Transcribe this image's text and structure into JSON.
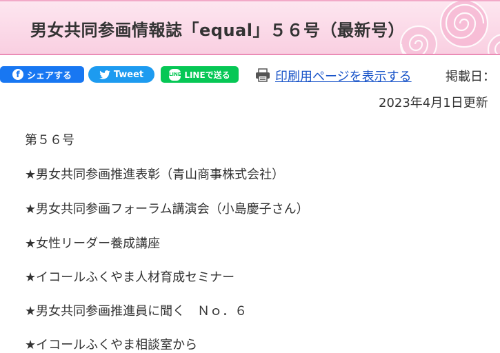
{
  "header": {
    "title": "男女共同参画情報誌「equal」５６号（最新号）",
    "accent_color": "#f9cfe1",
    "decoration": "rose-icon"
  },
  "share": {
    "facebook_label": "シェアする",
    "facebook_icon": "f",
    "twitter_label": "Tweet",
    "line_label": "LINEで送る",
    "line_icon": "LINE"
  },
  "print": {
    "label": "印刷用ページを表示する",
    "icon": "printer-icon"
  },
  "meta": {
    "posted_label": "掲載日：",
    "updated": "2023年4月1日更新"
  },
  "content": {
    "issue": "第５６号",
    "items": [
      "★男女共同参画推進表彰（青山商事株式会社）",
      "★男女共同参画フォーラム講演会（小島慶子さん）",
      "★女性リーダー養成講座",
      "★イコールふくやま人材育成セミナー",
      "★男女共同参画推進員に聞く　Ｎｏ．６",
      "★イコールふくやま相談室から"
    ]
  }
}
